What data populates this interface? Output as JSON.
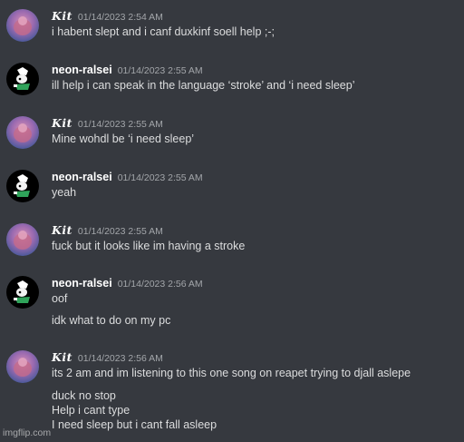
{
  "messages": [
    {
      "user": "Kit",
      "time": "01/14/2023 2:54 AM",
      "lines": [
        "i habent slept and i canf duxkinf soell help ;-;"
      ]
    },
    {
      "user": "neon-ralsei",
      "time": "01/14/2023 2:55 AM",
      "lines": [
        "ill help i can speak in the language ‘stroke’ and ‘i need sleep’"
      ]
    },
    {
      "user": "Kit",
      "time": "01/14/2023 2:55 AM",
      "lines": [
        "Mine wohdl be ‘i need sleep’"
      ]
    },
    {
      "user": "neon-ralsei",
      "time": "01/14/2023 2:55 AM",
      "lines": [
        "yeah"
      ]
    },
    {
      "user": "Kit",
      "time": "01/14/2023 2:55 AM",
      "lines": [
        "fuck but it looks like im having a stroke"
      ]
    },
    {
      "user": "neon-ralsei",
      "time": "01/14/2023 2:56 AM",
      "lines": [
        "oof",
        "idk what to do on my pc"
      ]
    },
    {
      "user": "Kit",
      "time": "01/14/2023 2:56 AM",
      "lines": [
        "its 2 am and im listening to this one song on reapet trying to djall aslepe",
        "duck no stop",
        "Help i cant type",
        "I need sleep but i cant fall asleep"
      ]
    }
  ],
  "watermark": "imgflip.com",
  "colors": {
    "background": "#36393f",
    "text": "#dcddde",
    "username": "#ffffff",
    "timestamp": "#a3a6aa"
  },
  "icons": {
    "kit_avatar": "purple-pink-blob-avatar",
    "ralsei_avatar": "dark-creature-avatar"
  }
}
